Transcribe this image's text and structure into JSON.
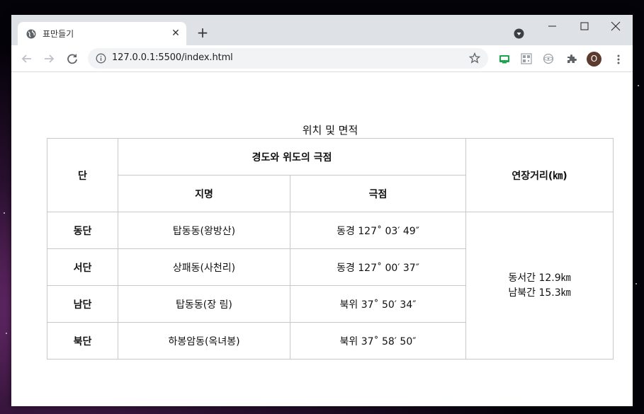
{
  "browser": {
    "tab": {
      "title": "표만들기",
      "favicon": "globe-icon",
      "close_icon": "close-icon"
    },
    "new_tab_icon": "plus-icon",
    "window_controls": [
      "minimize-icon",
      "maximize-icon",
      "close-icon"
    ],
    "nav": [
      "back-arrow-icon",
      "forward-arrow-icon",
      "reload-icon"
    ],
    "address": {
      "url": "127.0.0.1:5500/index.html",
      "info_icon": "info-icon",
      "bookmark_icon": "star-icon"
    },
    "extensions": [
      "screen-cast-icon",
      "qr-icon",
      "react-devtools-icon",
      "puzzle-icon"
    ],
    "profile": {
      "initial": "O",
      "color": "#5d3a2e"
    },
    "menu_icon": "kebab-menu-icon"
  },
  "table": {
    "caption": "위치 및 면적",
    "headers": {
      "dan": "단",
      "extreme_group": "경도와 위도의 극점",
      "place": "지명",
      "extreme": "극점",
      "length": "연장거리(㎞)"
    },
    "rows": [
      {
        "dan": "동단",
        "place": "탑동동(왕방산)",
        "extreme": "동경 127˚ 03′ 49″"
      },
      {
        "dan": "서단",
        "place": "상패동(사천리)",
        "extreme": "동경 127˚ 00′ 37″"
      },
      {
        "dan": "남단",
        "place": "탑동동(장  림)",
        "extreme": "북위 37˚ 50′ 34″"
      },
      {
        "dan": "북단",
        "place": "하봉암동(옥녀봉)",
        "extreme": "북위 37˚ 58′ 50″"
      }
    ],
    "length_values": {
      "east_west": "동서간 12.9㎞",
      "north_south": "남북간 15.3㎞"
    }
  },
  "colors": {
    "titlebar": "#dee1e6",
    "border": "#c8c8c8",
    "accent_green": "#1aa64a"
  }
}
